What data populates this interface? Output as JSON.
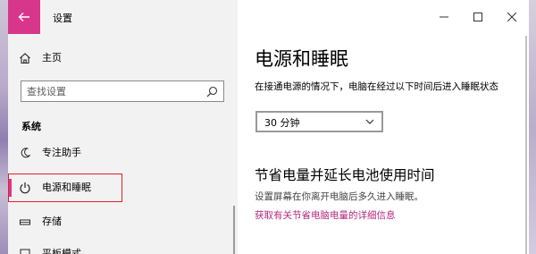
{
  "window": {
    "app_title": "设置"
  },
  "nav": {
    "home": "主页",
    "search_placeholder": "查找设置",
    "section_title": "系统",
    "items": [
      {
        "label": "专注助手",
        "icon": "moon-icon"
      },
      {
        "label": "电源和睡眠",
        "icon": "power-icon",
        "selected": true
      },
      {
        "label": "存储",
        "icon": "storage-icon"
      },
      {
        "label": "平板模式",
        "icon": "tablet-icon"
      }
    ]
  },
  "content": {
    "page_title": "电源和睡眠",
    "screen_desc": "在接通电源的情况下，电脑在经过以下时间后进入睡眠状态",
    "sleep_value": "30 分钟",
    "section2_title": "节省电量并延长电池使用时间",
    "section2_desc": "设置屏幕在你离开电脑后多久进入睡眠。",
    "section2_link": "获取有关节省电脑电量的详细信息"
  },
  "colors": {
    "accent": "#d8368b",
    "highlight_box": "#e0222a",
    "link": "#b5267b"
  }
}
